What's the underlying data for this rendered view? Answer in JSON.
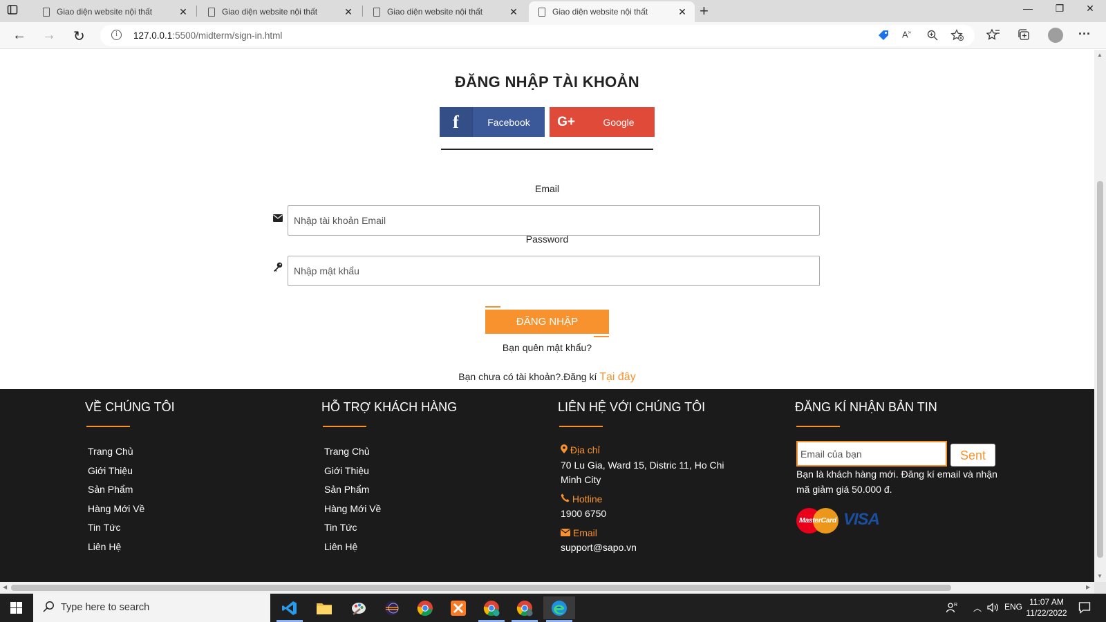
{
  "browser": {
    "tabs": [
      {
        "title": "Giao diện website nội thất",
        "close": "✕"
      },
      {
        "title": "Giao diện website nội thất",
        "close": "✕"
      },
      {
        "title": "Giao diện website nội thất",
        "close": "✕"
      },
      {
        "title": "Giao diện website nội thất",
        "close": "✕"
      }
    ],
    "new_tab": "+",
    "window_controls": {
      "minimize": "—",
      "restore": "❐",
      "close": "✕"
    },
    "url_host": "127.0.0.1",
    "url_path": ":5500/midterm/sign-in.html",
    "nav": {
      "back": "←",
      "forward": "→",
      "reload": "↻"
    },
    "more": "···"
  },
  "login": {
    "title": "ĐĂNG NHẬP TÀI KHOẢN",
    "facebook": {
      "icon": "f",
      "label": "Facebook"
    },
    "google": {
      "icon": "G+",
      "label": "Google"
    },
    "email_label": "Email",
    "email_placeholder": "Nhập tài khoản Email",
    "password_label": "Password",
    "password_placeholder": "Nhập mật khẩu",
    "submit_label": "ĐĂNG NHẬP",
    "forgot_label": "Bạn quên mật khẩu?",
    "register_prompt": "Bạn chưa có tài khoản?.Đăng kí ",
    "register_link": "Tại đây"
  },
  "footer": {
    "about": {
      "heading": "VỀ CHÚNG TÔI",
      "links": [
        "Trang Chủ",
        "Giới Thiệu",
        "Sản Phẩm",
        "Hàng Mới Về",
        "Tin Tức",
        "Liên Hệ"
      ]
    },
    "support": {
      "heading": "HỖ TRỢ KHÁCH HÀNG",
      "links": [
        "Trang Chủ",
        "Giới Thiệu",
        "Sản Phẩm",
        "Hàng Mới Về",
        "Tin Tức",
        "Liên Hệ"
      ]
    },
    "contact": {
      "heading": "LIÊN HỆ VỚI CHÚNG TÔI",
      "address_label": "Địa chỉ",
      "address": "70 Lu Gia, Ward 15, Distric 11, Ho Chi Minh City",
      "hotline_label": "Hotline",
      "hotline": "1900 6750",
      "email_label": "Email",
      "email": "support@sapo.vn"
    },
    "newsletter": {
      "heading": "ĐĂNG KÍ NHẬN BẢN TIN",
      "placeholder": "Email của bạn",
      "button": "Sent",
      "note": "Bạn là khách hàng mới. Đăng kí email và nhận mã giảm giá 50.000 đ.",
      "payment": [
        "MasterCard",
        "VISA"
      ]
    }
  },
  "taskbar": {
    "search_placeholder": "Type here to search",
    "lang": "ENG",
    "time": "11:07 AM",
    "date": "11/22/2022"
  },
  "colors": {
    "accent": "#f7922e",
    "facebook": "#3b5998",
    "google": "#e04a39",
    "footer_bg": "#1b1b1b"
  }
}
